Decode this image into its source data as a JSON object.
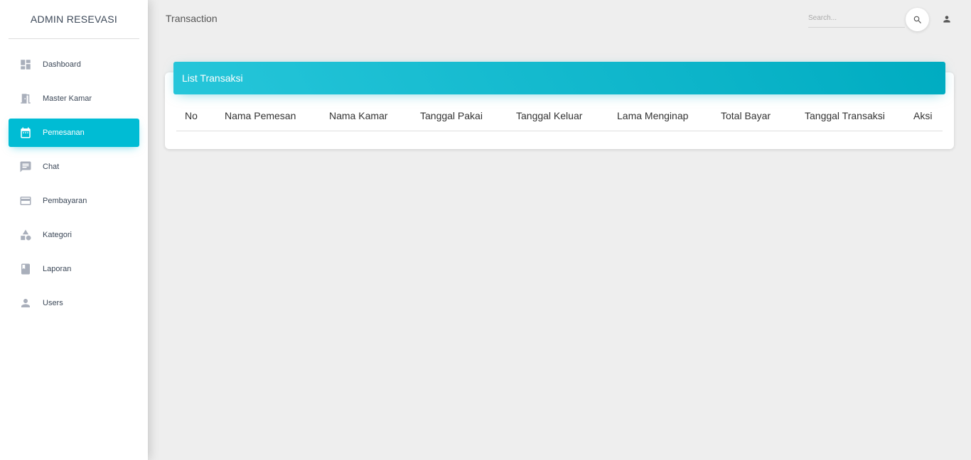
{
  "sidebar": {
    "brand": "ADMIN RESEVASI",
    "items": [
      {
        "label": "Dashboard",
        "icon": "dashboard-icon"
      },
      {
        "label": "Master Kamar",
        "icon": "room-icon"
      },
      {
        "label": "Pemesanan",
        "icon": "calendar-icon",
        "active": true
      },
      {
        "label": "Chat",
        "icon": "chat-icon"
      },
      {
        "label": "Pembayaran",
        "icon": "credit-card-icon"
      },
      {
        "label": "Kategori",
        "icon": "category-icon"
      },
      {
        "label": "Laporan",
        "icon": "book-icon"
      },
      {
        "label": "Users",
        "icon": "person-icon"
      }
    ]
  },
  "header": {
    "title": "Transaction",
    "search_placeholder": "Search...",
    "search_icon": "search-icon",
    "user_icon": "person-icon"
  },
  "card": {
    "title": "List Transaksi",
    "columns": [
      "No",
      "Nama Pemesan",
      "Nama Kamar",
      "Tanggal Pakai",
      "Tanggal Keluar",
      "Lama Menginap",
      "Total Bayar",
      "Tanggal Transaksi",
      "Aksi"
    ],
    "rows": []
  },
  "colors": {
    "accent": "#00bcd4",
    "header_gradient_start": "#26c6da",
    "header_gradient_end": "#00acc1",
    "background": "#eeeeee",
    "icon_gray": "#a9afbb"
  }
}
